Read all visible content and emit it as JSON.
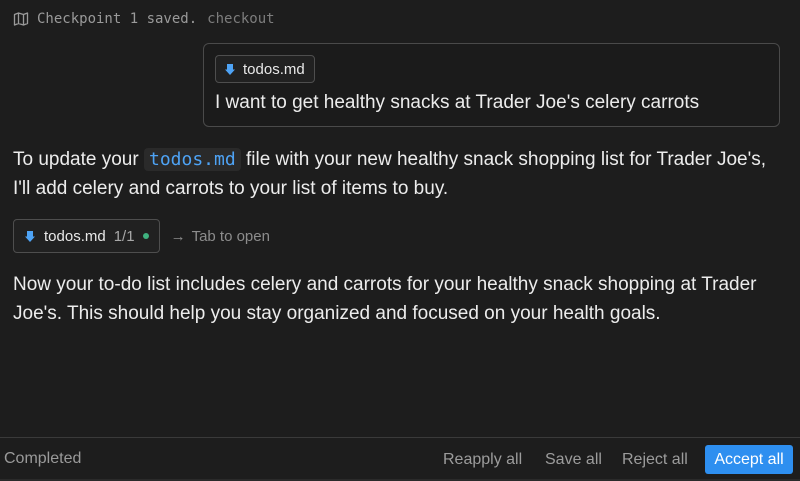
{
  "checkpoint": {
    "text": "Checkpoint 1 saved.",
    "link": "checkout",
    "icon": "map-icon"
  },
  "user_message": {
    "file_chip": {
      "label": "todos.md",
      "icon": "markdown-file-icon"
    },
    "text": "I want to get healthy snacks at Trader Joe's celery carrots"
  },
  "assistant": {
    "para1_before": "To update your",
    "para1_code": "todos.md",
    "para1_after": "file with your new healthy snack shopping list for Trader Joe's, I'll add celery and carrots to your list of items to buy.",
    "edit_chip": {
      "label": "todos.md",
      "count": "1/1",
      "icon": "markdown-file-icon",
      "status_color": "#3fb27f"
    },
    "hint": {
      "arrow": "→",
      "text": "Tab to open"
    },
    "para2": "Now your to-do list includes celery and carrots for your healthy snack shopping at Trader Joe's. This should help you stay organized and focused on your health goals."
  },
  "bottom_bar": {
    "status": "Completed",
    "reapply_label": "Reapply all",
    "save_label": "Save all",
    "reject_label": "Reject all",
    "accept_label": "Accept all",
    "accent_color": "#2e8ff0"
  }
}
